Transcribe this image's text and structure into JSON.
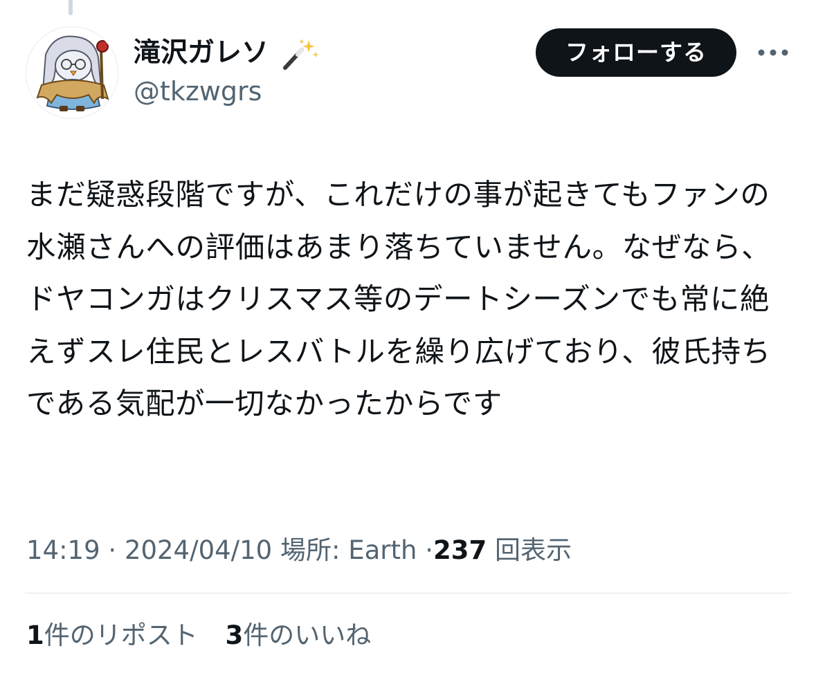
{
  "tweet": {
    "author": {
      "display_name": "滝沢ガレソ",
      "name_emoji": "magic-wand-icon",
      "handle": "@tkzwgrs"
    },
    "follow_label": "フォローする",
    "more_icon": "more-dots-icon",
    "text": "まだ疑惑段階ですが、これだけの事が起きてもファンの水瀬さんへの評価はあまり落ちていません。なぜなら、ドヤコンガはクリスマス等のデートシーズンでも常に絶えずスレ住民とレスバトルを繰り広げており、彼氏持ちである気配が一切なかったからです",
    "meta": {
      "time": "14:19",
      "separator": "·",
      "date": "2024/04/10",
      "location_label": "場所: Earth",
      "views_count": "237",
      "views_label": "回表示"
    },
    "stats": {
      "reposts_count": "1",
      "reposts_label": "件のリポスト",
      "likes_count": "3",
      "likes_label": "件のいいね"
    }
  },
  "colors": {
    "text_primary": "#0f1419",
    "text_secondary": "#536471",
    "follow_bg": "#0f1419",
    "follow_text": "#ffffff",
    "divider": "#dfe4e8"
  }
}
